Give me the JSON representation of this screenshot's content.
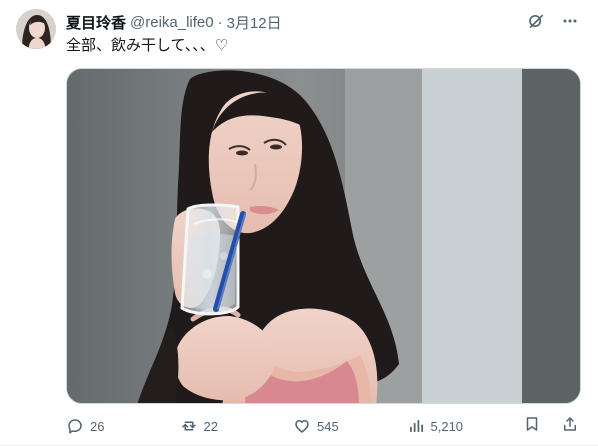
{
  "tweet": {
    "display_name": "夏目玲香",
    "handle": "@reika_life0",
    "separator": "·",
    "date": "3月12日",
    "text": "全部、飲み干して、、、♡"
  },
  "media": {
    "subject": "woman drinking from a glass with a blue straw"
  },
  "actions": {
    "replies": "26",
    "reposts": "22",
    "likes": "545",
    "views": "5,210"
  },
  "icons": {
    "header_left": "grok-icon",
    "header_right": "more-icon",
    "reply": "reply-icon",
    "repost": "repost-icon",
    "like": "like-icon",
    "views": "views-icon",
    "bookmark": "bookmark-icon",
    "share": "share-icon"
  },
  "colors": {
    "text_primary": "#0f1419",
    "text_secondary": "#536471",
    "border": "#cfd9de"
  }
}
